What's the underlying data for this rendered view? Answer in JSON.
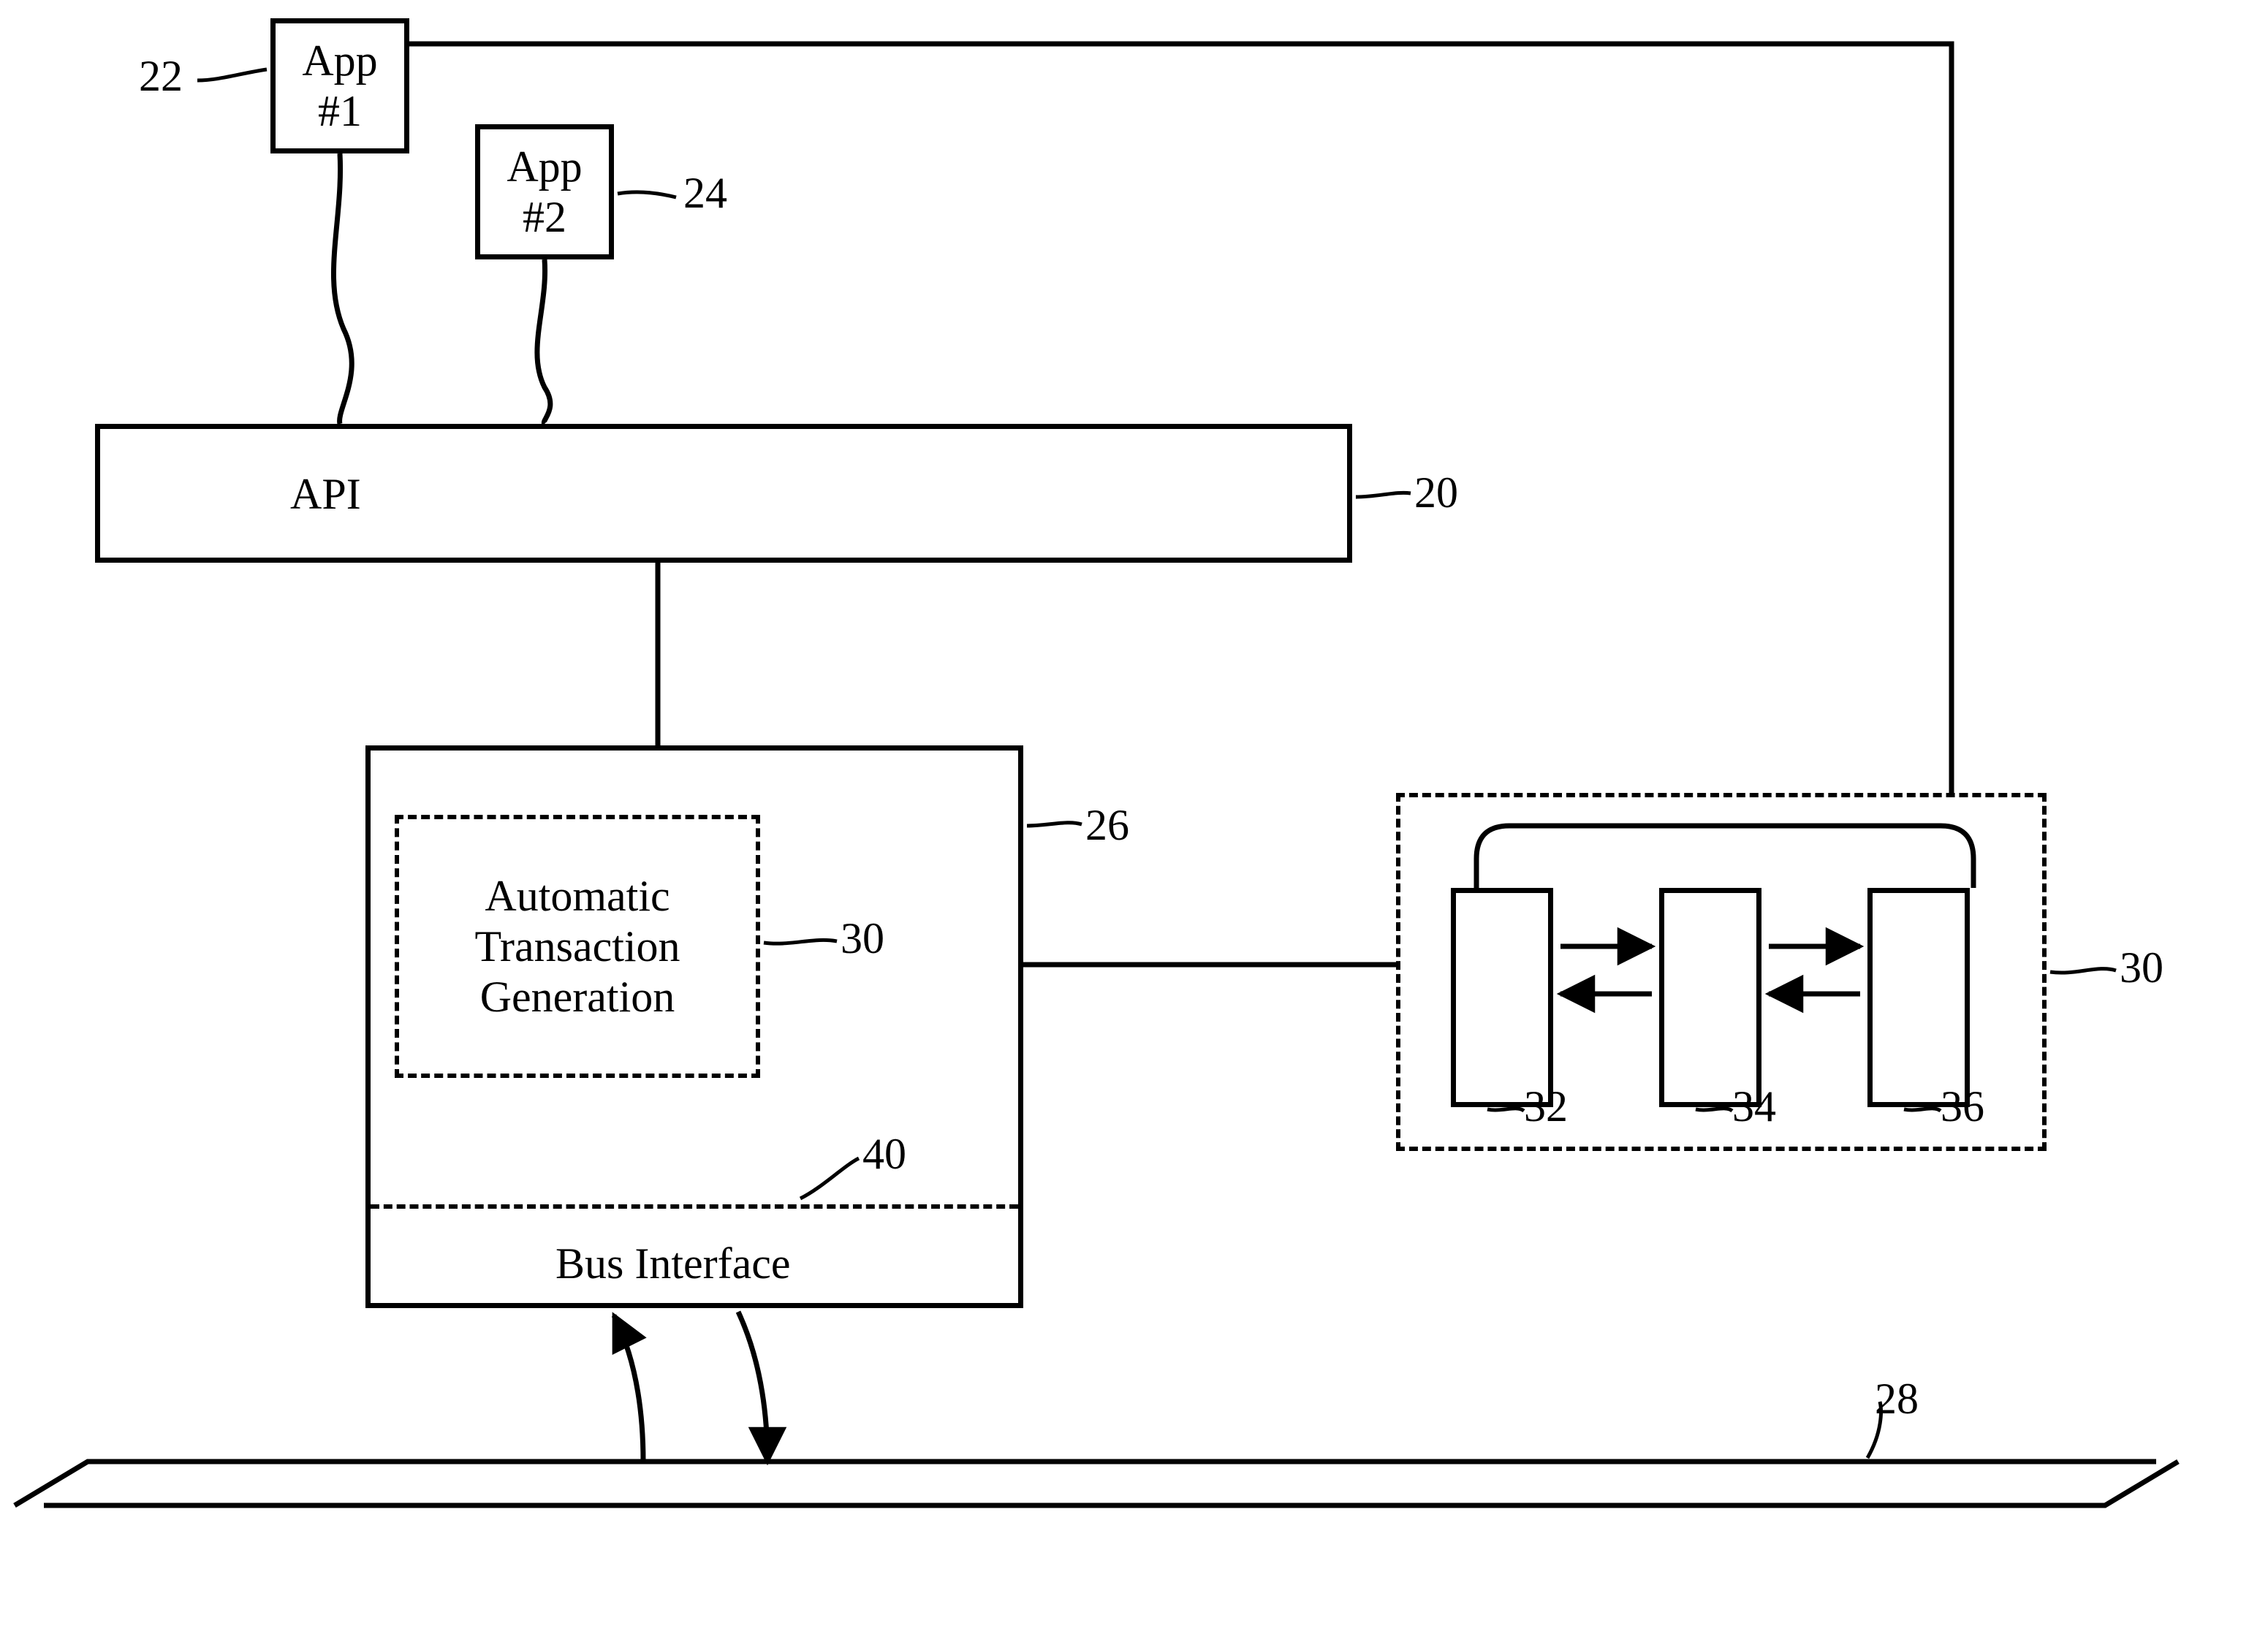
{
  "app1": {
    "line1": "App",
    "line2": "#1"
  },
  "app2": {
    "line1": "App",
    "line2": "#2"
  },
  "api": {
    "label": "API"
  },
  "atg": {
    "line1": "Automatic",
    "line2": "Transaction",
    "line3": "Generation"
  },
  "bus": {
    "label": "Bus Interface"
  },
  "refs": {
    "r22": "22",
    "r24": "24",
    "r20": "20",
    "r26": "26",
    "r30a": "30",
    "r30b": "30",
    "r40": "40",
    "r32": "32",
    "r34": "34",
    "r36": "36",
    "r28": "28"
  }
}
